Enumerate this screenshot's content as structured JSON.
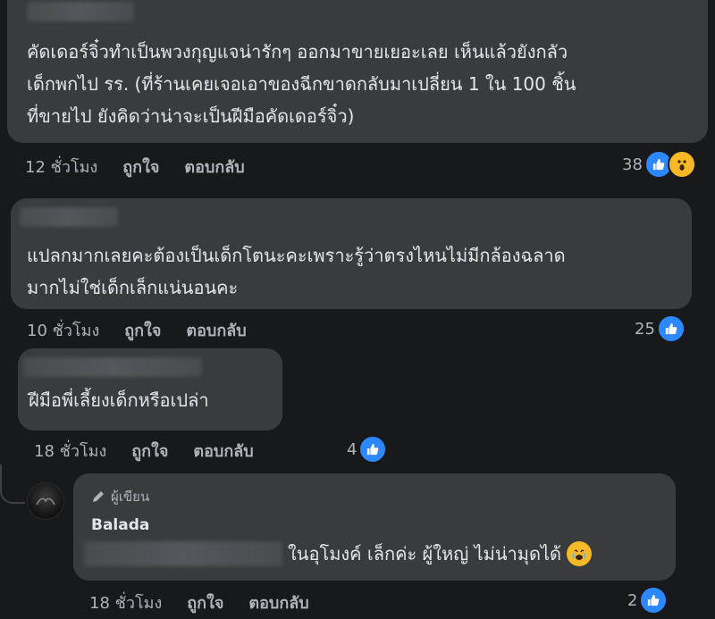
{
  "comments": [
    {
      "text_lines": [
        "คัดเดอร์จิ๋วทำเป็นพวงกุญแจน่ารักๆ ออกมาขายเยอะเลย เห็นแล้วยังกลัว",
        "เด็กพกไป รร. (ที่ร้านเคยเจอเอาของฉีกขาดกลับมาเปลี่ยน 1 ใน 100 ชิ้น",
        "ที่ขายไป ยังคิดว่าน่าจะเป็นฝีมือคัดเดอร์จิ๋ว)"
      ],
      "time": "12 ชั่วโมง",
      "like_label": "ถูกใจ",
      "reply_label": "ตอบกลับ",
      "reaction_count": "38",
      "reactions": [
        "like-icon",
        "wow-icon"
      ]
    },
    {
      "text_lines": [
        "แปลกมากเลยคะต้องเป็นเด็กโตนะคะเพราะรู้ว่าตรงไหนไม่มีกล้องฉลาด",
        "มากไม่ใช่เด็กเล็กแน่นอนคะ"
      ],
      "time": "10 ชั่วโมง",
      "like_label": "ถูกใจ",
      "reply_label": "ตอบกลับ",
      "reaction_count": "25",
      "reactions": [
        "like-icon"
      ]
    },
    {
      "text_lines": [
        "ฝีมือพี่เลี้ยงเด็กหรือเปล่า"
      ],
      "time": "18 ชั่วโมง",
      "like_label": "ถูกใจ",
      "reply_label": "ตอบกลับ",
      "reaction_count": "4",
      "reactions": [
        "like-icon"
      ]
    }
  ],
  "reply": {
    "author_badge": "ผู้เขียน",
    "author_name": "Balada",
    "text": "ในอุโมงค์ เล็กค่ะ ผู้ใหญ่ ไม่น่ามุดได้",
    "emoji": "😭",
    "time": "18 ชั่วโมง",
    "like_label": "ถูกใจ",
    "reply_label": "ตอบกลับ",
    "reaction_count": "2",
    "reactions": [
      "like-icon"
    ]
  },
  "colors": {
    "background": "#18191a",
    "bubble": "#3a3b3c",
    "like_blue": "#2d88ff",
    "wow_yellow": "#f7b928"
  }
}
